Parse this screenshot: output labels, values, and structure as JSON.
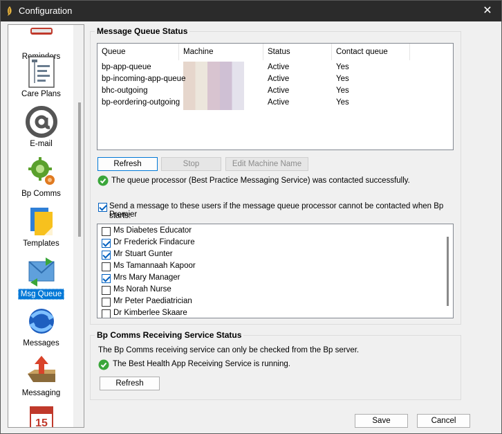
{
  "window": {
    "title": "Configuration",
    "close_glyph": "✕"
  },
  "sidebar": {
    "items": [
      {
        "label": "Reminders",
        "icon": "reminders-icon"
      },
      {
        "label": "Care Plans",
        "icon": "care-plans-icon"
      },
      {
        "label": "E-mail",
        "icon": "email-at-icon"
      },
      {
        "label": "Bp Comms",
        "icon": "gear-globe-icon"
      },
      {
        "label": "Templates",
        "icon": "templates-icon"
      },
      {
        "label": "Msg Queue",
        "icon": "msg-queue-icon",
        "selected": true
      },
      {
        "label": "Messages",
        "icon": "messages-icon"
      },
      {
        "label": "Messaging",
        "icon": "messaging-inbox-icon"
      },
      {
        "label": "",
        "icon": "calendar-icon"
      }
    ],
    "calendar_day": "15"
  },
  "queue_status": {
    "title": "Message Queue Status",
    "columns": [
      "Queue",
      "Machine",
      "Status",
      "Contact queue"
    ],
    "rows": [
      {
        "queue": "bp-app-queue",
        "machine": "",
        "status": "Active",
        "contact": "Yes"
      },
      {
        "queue": "bp-incoming-app-queue",
        "machine": "",
        "status": "Active",
        "contact": "Yes"
      },
      {
        "queue": "bhc-outgoing",
        "machine": "",
        "status": "Active",
        "contact": "Yes"
      },
      {
        "queue": "bp-eordering-outgoing",
        "machine": "",
        "status": "Active",
        "contact": "Yes"
      }
    ],
    "buttons": {
      "refresh": "Refresh",
      "stop": "Stop",
      "edit_machine": "Edit Machine Name"
    },
    "processor_status": "The queue processor (Best Practice Messaging Service) was contacted successfully.",
    "send_message_checkbox": {
      "label_line1": "Send a message to these users if the message queue processor cannot be contacted when Bp Premier",
      "label_line2": "starts:",
      "checked": true
    },
    "users": [
      {
        "name": "Ms Diabetes Educator",
        "checked": false
      },
      {
        "name": "Dr Frederick Findacure",
        "checked": true
      },
      {
        "name": "Mr Stuart Gunter",
        "checked": true
      },
      {
        "name": "Ms Tamannaah Kapoor",
        "checked": false
      },
      {
        "name": "Mrs Mary Manager",
        "checked": true
      },
      {
        "name": "Ms Norah Nurse",
        "checked": false
      },
      {
        "name": "Mr Peter Paediatrician",
        "checked": false
      },
      {
        "name": "Dr Kimberlee Skaare",
        "checked": false
      }
    ]
  },
  "receiving_status": {
    "title": "Bp Comms Receiving Service Status",
    "info": "The Bp Comms receiving service can only be checked from the Bp server.",
    "service_status": "The Best Health App Receiving Service is running.",
    "refresh_label": "Refresh"
  },
  "footer": {
    "save_label": "Save",
    "cancel_label": "Cancel"
  },
  "colors": {
    "accent": "#0078d7",
    "ok_green": "#3aa63a",
    "titlebar": "#2b2b2b"
  }
}
